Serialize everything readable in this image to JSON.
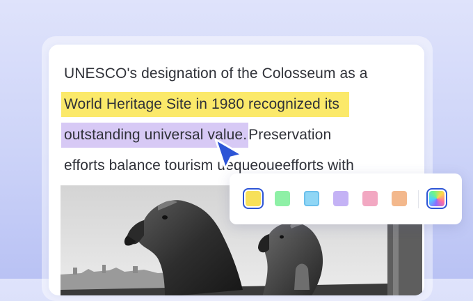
{
  "paragraph": {
    "line1": "UNESCO's designation of the Colosseum as a",
    "line2_highlight": "World Heritage Site in 1980 recognized its",
    "line3_highlight": "outstanding universal value.",
    "line3_rest": " Preservation",
    "line4": "efforts balance tourism uequeoueefforts with"
  },
  "highlight_colors": {
    "yellow": "#fbe96a",
    "purple": "#d7c9f5"
  },
  "toolbar": {
    "swatches": [
      {
        "name": "yellow",
        "color": "#f7e05a",
        "selected": true
      },
      {
        "name": "green",
        "color": "#8ef0a6",
        "selected": false
      },
      {
        "name": "light-blue",
        "color": "#8fd6f5",
        "selected": false
      },
      {
        "name": "purple",
        "color": "#c4b2f5",
        "selected": false
      },
      {
        "name": "pink",
        "color": "#f2a8c2",
        "selected": false
      },
      {
        "name": "orange",
        "color": "#f3b88c",
        "selected": false
      },
      {
        "name": "custom-color",
        "color": "multicolor",
        "selected": false
      }
    ]
  },
  "image": {
    "subject": "black-and-white photo of stone gargoyle statues"
  },
  "accent_color": "#2d55d6"
}
